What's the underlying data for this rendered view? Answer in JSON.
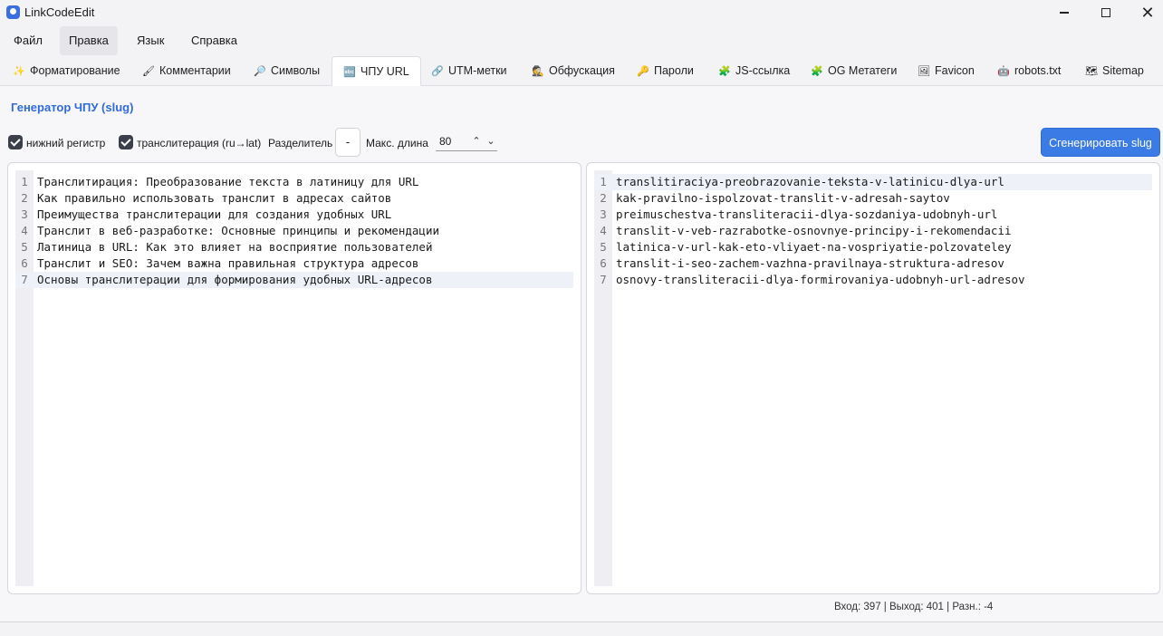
{
  "window": {
    "title": "LinkCodeEdit",
    "minimize_icon": "minimize-icon",
    "maximize_icon": "maximize-icon",
    "close_glyph": "✕"
  },
  "menu": {
    "items": [
      {
        "label": "Файл"
      },
      {
        "label": "Правка",
        "active": true
      },
      {
        "label": "Язык"
      },
      {
        "label": "Справка"
      }
    ]
  },
  "tabs": [
    {
      "icon": "✨",
      "label": "Форматирование"
    },
    {
      "icon": "🖌",
      "label": "Комментарии"
    },
    {
      "icon": "🔎",
      "label": "Символы"
    },
    {
      "icon": "🔤",
      "label": "ЧПУ URL",
      "active": true
    },
    {
      "icon": "🔗",
      "label": "UTM-метки"
    },
    {
      "icon": "🕵",
      "label": "Обфускация"
    },
    {
      "icon": "🔑",
      "label": "Пароли"
    },
    {
      "icon": "🧩",
      "label": "JS-ссылка"
    },
    {
      "icon": "🧩",
      "label": "OG Метатеги"
    },
    {
      "icon": "🖼",
      "label": "Favicon"
    },
    {
      "icon": "🤖",
      "label": "robots.txt"
    },
    {
      "icon": "🗺",
      "label": "Sitemap"
    }
  ],
  "section": {
    "title": "Генератор ЧПУ (slug)"
  },
  "options": {
    "lowercase_label": "нижний регистр",
    "lowercase_checked": true,
    "translit_label": "транслитерация (ru→lat)",
    "translit_checked": true,
    "separator_label": "Разделитель",
    "separator_value": "-",
    "maxlen_label": "Макс. длина",
    "maxlen_value": "80",
    "spin_up": "⌃",
    "spin_down": "⌄",
    "generate_label": "Сгенерировать slug"
  },
  "input_editor": {
    "lines": [
      {
        "n": "1",
        "text": "Транслитирация: Преобразование текста в латиницу для URL"
      },
      {
        "n": "2",
        "text": "Как правильно использовать транслит в адресах сайтов"
      },
      {
        "n": "3",
        "text": "Преимущества транслитерации для создания удобных URL"
      },
      {
        "n": "4",
        "text": "Транслит в веб-разработке: Основные принципы и рекомендации"
      },
      {
        "n": "5",
        "text": "Латиница в URL: Как это влияет на восприятие пользователей"
      },
      {
        "n": "6",
        "text": "Транслит и SEO: Зачем важна правильная структура адресов"
      },
      {
        "n": "7",
        "text": "Основы транслитерации для формирования удобных URL-адресов"
      }
    ]
  },
  "output_editor": {
    "lines": [
      {
        "n": "1",
        "text": "translitiraciya-preobrazovanie-teksta-v-latinicu-dlya-url"
      },
      {
        "n": "2",
        "text": "kak-pravilno-ispolzovat-translit-v-adresah-saytov"
      },
      {
        "n": "3",
        "text": "preimuschestva-transliteracii-dlya-sozdaniya-udobnyh-url"
      },
      {
        "n": "4",
        "text": "translit-v-veb-razrabotke-osnovnye-principy-i-rekomendacii"
      },
      {
        "n": "5",
        "text": "latinica-v-url-kak-eto-vliyaet-na-vospriyatie-polzovateley"
      },
      {
        "n": "6",
        "text": "translit-i-seo-zachem-vazhna-pravilnaya-struktura-adresov"
      },
      {
        "n": "7",
        "text": "osnovy-transliteracii-dlya-formirovaniya-udobnyh-url-adresov"
      }
    ]
  },
  "status": {
    "text": "Вход: 397 | Выход: 401 | Разн.: -4"
  }
}
